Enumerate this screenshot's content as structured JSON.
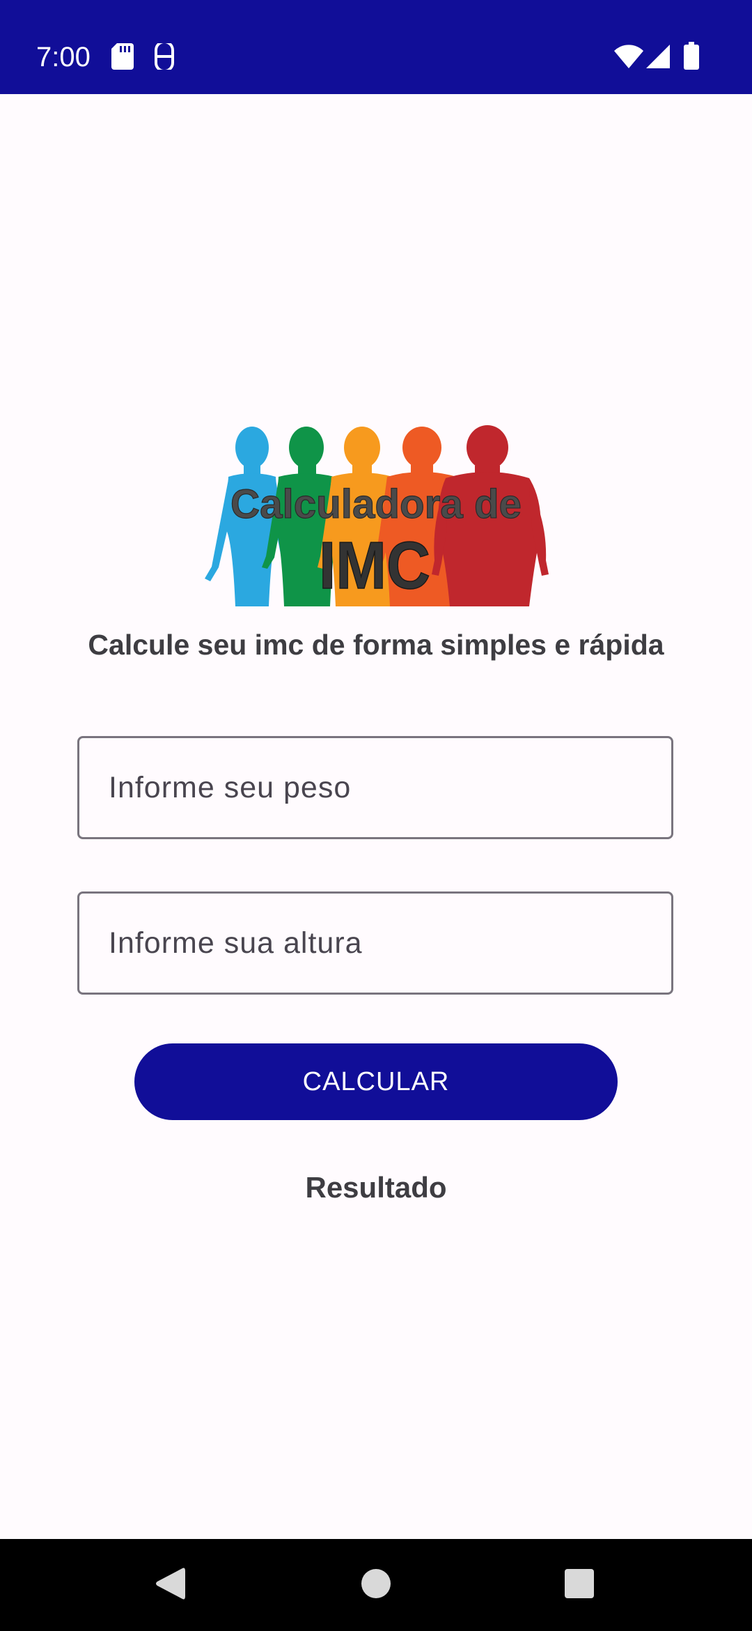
{
  "status_bar": {
    "time": "7:00",
    "icons": [
      "sd-card-icon",
      "face-icon",
      "wifi-icon",
      "signal-icon",
      "battery-icon"
    ],
    "background_color": "#110E98"
  },
  "logo": {
    "line1": "Calculadora de",
    "line2": "IMC",
    "figure_colors": [
      "#2BA8E0",
      "#0F9448",
      "#F79A1E",
      "#EE5A24",
      "#C0272D"
    ]
  },
  "tagline": "Calcule seu imc de forma simples e rápida",
  "inputs": {
    "weight": {
      "value": "",
      "placeholder": "Informe seu peso"
    },
    "height": {
      "value": "",
      "placeholder": "Informe sua altura"
    }
  },
  "calculate_button": {
    "label": "CALCULAR",
    "color": "#110E98"
  },
  "result_label": "Resultado",
  "nav_bar": {
    "icons": [
      "back-icon",
      "home-icon",
      "recents-icon"
    ]
  }
}
